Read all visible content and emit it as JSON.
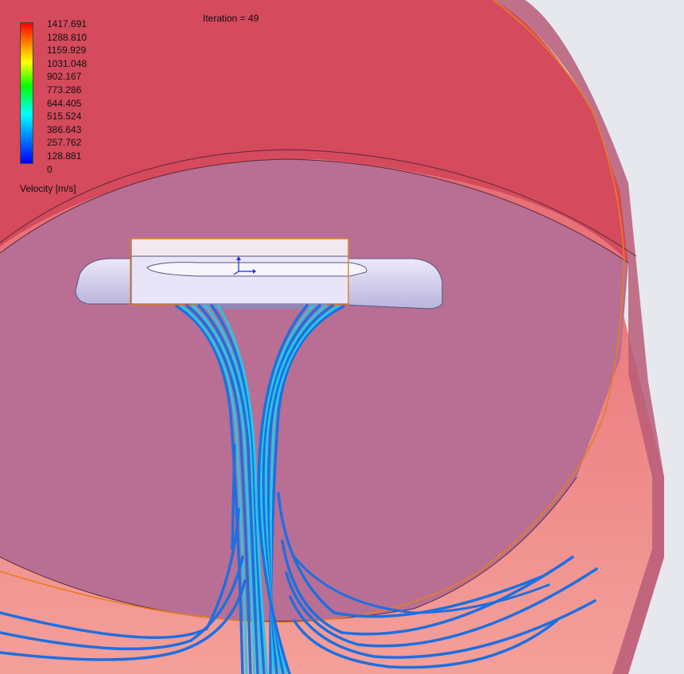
{
  "legend": {
    "title": "Velocity [m/s]",
    "ticks": [
      "1417.691",
      "1288.810",
      "1159.929",
      "1031.048",
      "902.167",
      "773.286",
      "644.405",
      "515.524",
      "386.643",
      "257.762",
      "128.881",
      "0"
    ]
  },
  "iteration_label": "Iteration = 49",
  "colors": {
    "background": "#e6e8ee",
    "outer_wall": "#d54a5c",
    "inner_region": "#b86f93",
    "lower_wall": "#f08a8a",
    "boundary_orange": "#e87d1e",
    "streamline_blue": "#1e6fe0",
    "streamline_cyan": "#27c7e6",
    "body_lavender": "#d7d4f0"
  },
  "icons": {
    "axis_triad": "axis-triad-icon"
  }
}
